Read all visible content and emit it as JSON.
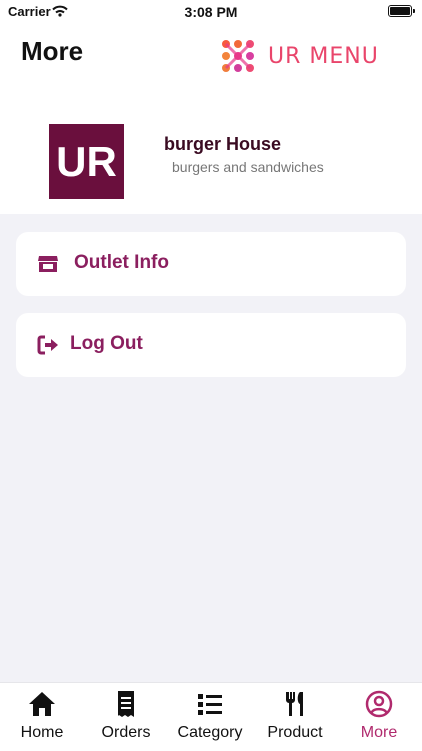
{
  "status_bar": {
    "carrier": "Carrier",
    "time": "3:08 PM"
  },
  "header": {
    "title": "More",
    "brand_text": "UR MENU"
  },
  "store": {
    "avatar_text": "UR",
    "name": "burger House",
    "description": "burgers and sandwiches"
  },
  "menu": [
    {
      "label": "Outlet Info",
      "icon": "store-icon"
    },
    {
      "label": "Log Out",
      "icon": "logout-icon"
    }
  ],
  "tabs": [
    {
      "label": "Home",
      "icon": "home-icon"
    },
    {
      "label": "Orders",
      "icon": "receipt-icon"
    },
    {
      "label": "Category",
      "icon": "list-icon"
    },
    {
      "label": "Product",
      "icon": "utensils-icon"
    },
    {
      "label": "More",
      "icon": "user-circle-icon",
      "active": true
    }
  ],
  "colors": {
    "accent": "#8b1f5f",
    "avatar_bg": "#6a0f3d",
    "active_tab": "#b02a6d",
    "background": "#f2f2f7"
  }
}
